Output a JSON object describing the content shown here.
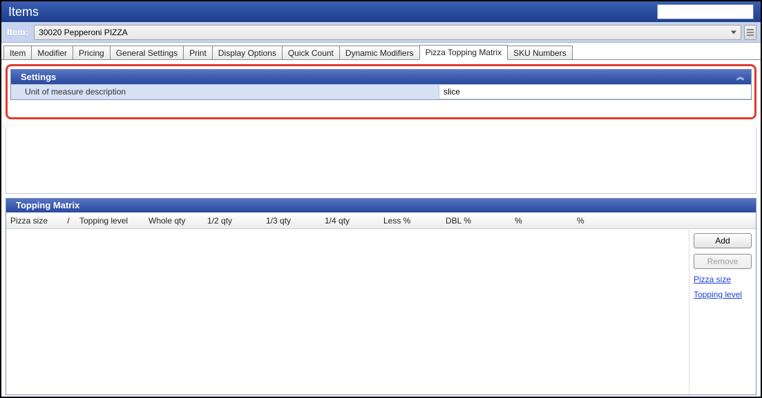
{
  "window": {
    "title": "Items"
  },
  "item": {
    "label": "Item:",
    "value": "30020 Pepperoni PIZZA"
  },
  "tabs": [
    {
      "label": "Item",
      "active": false
    },
    {
      "label": "Modifier",
      "active": false
    },
    {
      "label": "Pricing",
      "active": false
    },
    {
      "label": "General Settings",
      "active": false
    },
    {
      "label": "Print",
      "active": false
    },
    {
      "label": "Display Options",
      "active": false
    },
    {
      "label": "Quick Count",
      "active": false
    },
    {
      "label": "Dynamic Modifiers",
      "active": false
    },
    {
      "label": "Pizza Topping Matrix",
      "active": true
    },
    {
      "label": "SKU Numbers",
      "active": false
    }
  ],
  "settings_panel": {
    "title": "Settings",
    "row_label": "Unit of measure description",
    "row_value": "slice"
  },
  "topping_panel": {
    "title": "Topping Matrix",
    "columns": {
      "pizza_size": "Pizza size",
      "slash": "/",
      "topping_level": "Topping level",
      "whole_qty": "Whole qty",
      "half_qty": "1/2 qty",
      "third_qty": "1/3 qty",
      "quarter_qty": "1/4 qty",
      "less_pct": "Less %",
      "dbl_pct": "DBL %",
      "pct1": "%",
      "pct2": "%"
    },
    "buttons": {
      "add": "Add",
      "remove": "Remove"
    },
    "links": {
      "pizza_size": "Pizza size",
      "topping_level": "Topping level"
    },
    "rows": []
  }
}
